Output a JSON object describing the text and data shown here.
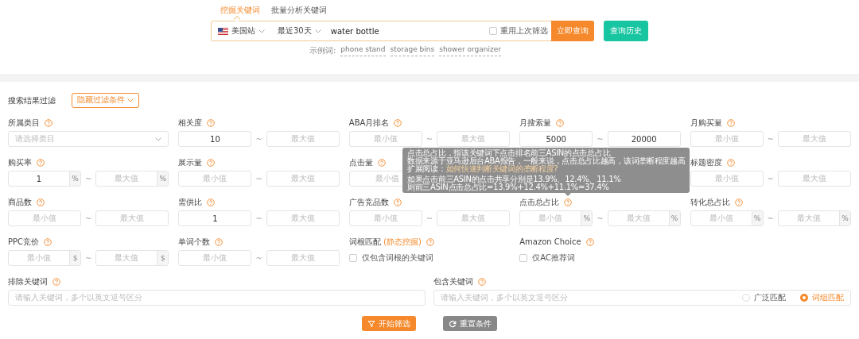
{
  "tabs": [
    {
      "label": "挖掘关键词",
      "selected": true
    },
    {
      "label": "批量分析关键词",
      "selected": false
    }
  ],
  "search": {
    "site": "美国站",
    "period": "最近30天",
    "value": "water bottle",
    "reuse_label": "重用上次筛选",
    "reuse_checked": false,
    "submit": "立即查询",
    "history": "查询历史"
  },
  "examples": {
    "label": "示例词:",
    "words": [
      "phone stand",
      "storage bins",
      "shower organizer"
    ]
  },
  "filter": {
    "title": "搜索结果过滤",
    "toggle": "隐藏过滤条件"
  },
  "fields": [
    {
      "kind": "select",
      "label": "所属类目",
      "placeholder": "请选择类目"
    },
    {
      "kind": "range",
      "label": "相关度",
      "min": {
        "value": "10"
      },
      "separator": "~",
      "max": {
        "placeholder": "最大值"
      }
    },
    {
      "kind": "range",
      "label": "ABA月排名",
      "min": {
        "placeholder": "最小值"
      },
      "separator": "~",
      "max": {
        "placeholder": "最大值"
      }
    },
    {
      "kind": "range",
      "label": "月搜索量",
      "min": {
        "value": "5000"
      },
      "separator": "~",
      "max": {
        "value": "20000"
      }
    },
    {
      "kind": "range",
      "label": "月购买量",
      "min": {
        "placeholder": "最小值"
      },
      "separator": "~",
      "max": {
        "placeholder": "最大值"
      }
    },
    {
      "kind": "range",
      "label": "购买率",
      "min": {
        "value": "1",
        "unit": "%"
      },
      "separator": "~",
      "max": {
        "placeholder": "最大值",
        "unit": "%"
      }
    },
    {
      "kind": "range",
      "label": "展示量",
      "min": {
        "placeholder": "最小值"
      },
      "separator": "~",
      "max": {
        "placeholder": "最大值"
      }
    },
    {
      "kind": "range",
      "label": "点击量",
      "min": {
        "placeholder": "最小值"
      }
    },
    {
      "kind": "covered"
    },
    {
      "kind": "range",
      "label": "标题密度",
      "min": {
        "placeholder": "最小值"
      },
      "separator": "~",
      "max": {
        "placeholder": "最大值"
      }
    },
    {
      "kind": "range",
      "label": "商品数",
      "min": {
        "placeholder": "最小值"
      },
      "separator": "~",
      "max": {
        "placeholder": "最大值"
      }
    },
    {
      "kind": "range",
      "label": "需供比",
      "min": {
        "value": "1"
      },
      "separator": "~",
      "max": {
        "placeholder": "最大值"
      }
    },
    {
      "kind": "range",
      "label": "广告竞品数",
      "min": {
        "placeholder": "最小值"
      },
      "separator": "~",
      "max": {
        "placeholder": "最大值"
      }
    },
    {
      "kind": "range",
      "label": "点击总占比",
      "min": {
        "placeholder": "最小值",
        "unit": "%"
      },
      "separator": "~",
      "max": {
        "placeholder": "最大值",
        "unit": "%"
      }
    },
    {
      "kind": "range",
      "label": "转化总占比",
      "min": {
        "placeholder": "最小值",
        "unit": "%"
      },
      "separator": "~",
      "max": {
        "placeholder": "最大值",
        "unit": "%"
      }
    },
    {
      "kind": "range",
      "label": "PPC竞价",
      "min": {
        "placeholder": "最小值",
        "unit": "$"
      },
      "separator": "~",
      "max": {
        "placeholder": "最大值",
        "unit": "$"
      }
    },
    {
      "kind": "range",
      "label": "单词个数",
      "min": {
        "placeholder": "最小值"
      },
      "separator": "~",
      "max": {
        "placeholder": "最大值"
      }
    },
    {
      "kind": "checkbox",
      "label": "词根匹配",
      "tag": "(静态挖掘)",
      "option": "仅包含词根的关键词",
      "checked": false
    },
    {
      "kind": "checkbox",
      "label": "Amazon Choice",
      "option": "仅AC推荐词",
      "checked": false
    }
  ],
  "keywords": [
    {
      "label": "排除关键词",
      "placeholder": "请输入关键词，多个以英文逗号区分"
    },
    {
      "label": "包含关键词",
      "placeholder": "请输入关键词，多个以英文逗号区分",
      "match_options": [
        {
          "label": "广泛匹配",
          "selected": false
        },
        {
          "label": "词组匹配",
          "selected": true
        }
      ]
    }
  ],
  "tooltip": {
    "lines": [
      "点击总占比，指该关键词下点击排名前三ASIN的点击总占比",
      "数据来源于亚马逊后台ABA报告，一般来说，点击总占比越高，该词垄断程度越高"
    ],
    "link_prefix": "扩展阅读：",
    "link": "如何快速判断关键词的垄断程度?",
    "example": [
      "如果点击前三ASIN的点击共享分别是13.9%、12.4%、11.1%",
      "则前三ASIN点击总占比=13.9%+12.4%+11.1%=37.4%"
    ]
  },
  "buttons": [
    {
      "label": "开始筛选",
      "kind": "primary"
    },
    {
      "label": "重置条件",
      "kind": "secondary"
    }
  ]
}
